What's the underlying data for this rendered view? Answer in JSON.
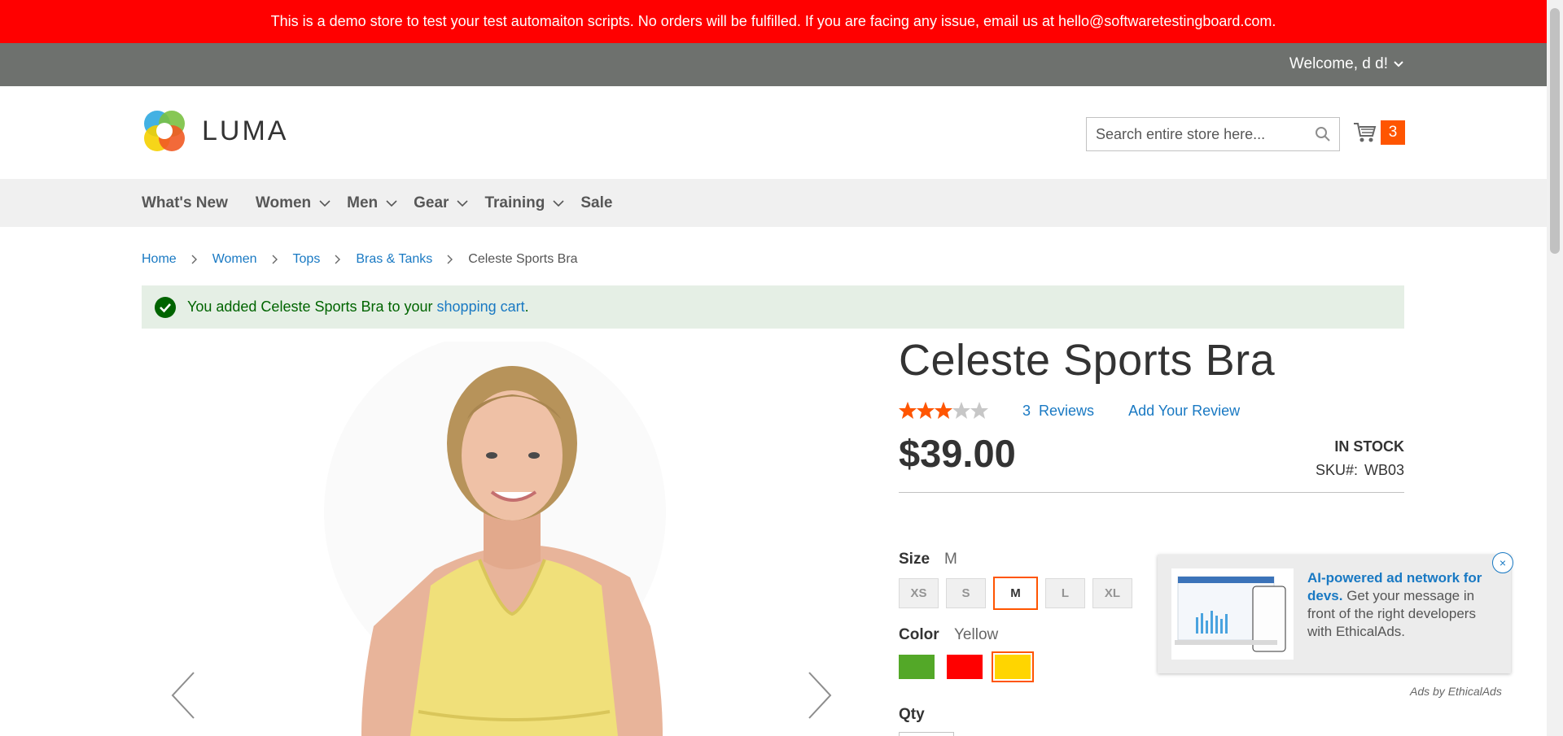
{
  "demo_banner": {
    "text": "This is a demo store to test your test automaiton scripts. No orders will be fulfilled. If you are facing any issue, email us at hello@softwaretestingboard.com."
  },
  "header": {
    "welcome": "Welcome, d d!",
    "logo_text": "LUMA",
    "search_placeholder": "Search entire store here...",
    "cart_count": "3"
  },
  "nav": {
    "items": [
      {
        "label": "What's New"
      },
      {
        "label": "Women"
      },
      {
        "label": "Men"
      },
      {
        "label": "Gear"
      },
      {
        "label": "Training"
      },
      {
        "label": "Sale"
      }
    ]
  },
  "breadcrumbs": {
    "items": [
      "Home",
      "Women",
      "Tops",
      "Bras & Tanks"
    ],
    "current": "Celeste Sports Bra"
  },
  "message": {
    "prefix": "You added Celeste Sports Bra to your ",
    "link": "shopping cart",
    "suffix": "."
  },
  "product": {
    "title": "Celeste Sports Bra",
    "rating_fraction": 0.6,
    "reviews_count": "3",
    "reviews_label": "Reviews",
    "add_review": "Add Your Review",
    "price": "$39.00",
    "stock": "IN STOCK",
    "sku_label": "SKU#:",
    "sku": "WB03",
    "size_label": "Size",
    "size_selected": "M",
    "sizes": [
      "XS",
      "S",
      "M",
      "L",
      "XL"
    ],
    "color_label": "Color",
    "color_selected": "Yellow",
    "colors": [
      "#53a828",
      "#ff0000",
      "#ffd500"
    ],
    "qty_label": "Qty"
  },
  "ad": {
    "headline": "AI-powered ad network for devs.",
    "body": " Get your message in front of the right developers with EthicalAds.",
    "close": "×",
    "attribution": "Ads by EthicalAds"
  },
  "colors": {
    "accent": "#ff5501",
    "link": "#1979c3",
    "banner": "#ff0000"
  }
}
